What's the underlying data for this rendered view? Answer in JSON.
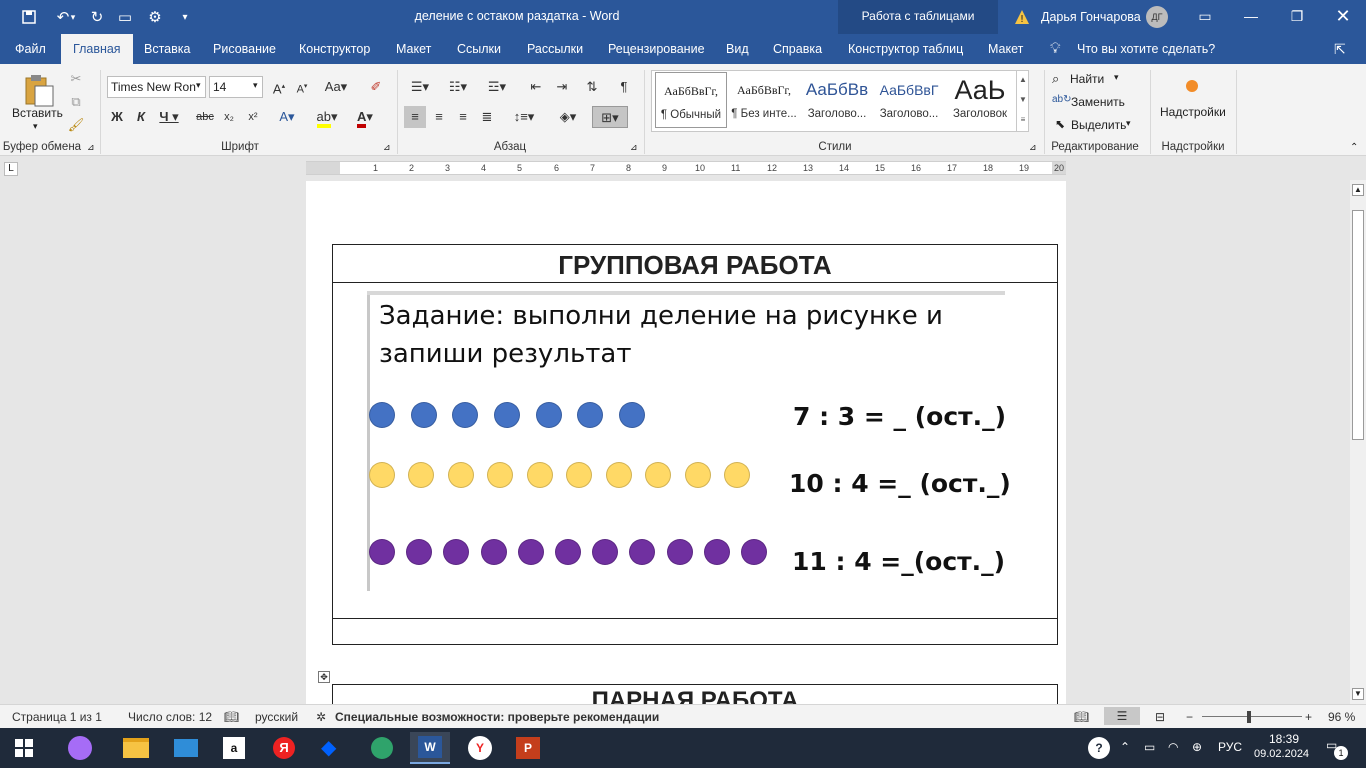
{
  "window": {
    "doc_title": "деление с остаком раздатка  -  Word",
    "table_tools": "Работа с таблицами",
    "user_name": "Дарья Гончарова",
    "user_initials": "ДГ"
  },
  "tabs": [
    {
      "label": "Файл"
    },
    {
      "label": "Главная"
    },
    {
      "label": "Вставка"
    },
    {
      "label": "Рисование"
    },
    {
      "label": "Конструктор"
    },
    {
      "label": "Макет"
    },
    {
      "label": "Ссылки"
    },
    {
      "label": "Рассылки"
    },
    {
      "label": "Рецензирование"
    },
    {
      "label": "Вид"
    },
    {
      "label": "Справка"
    },
    {
      "label": "Конструктор таблиц"
    },
    {
      "label": "Макет"
    }
  ],
  "tell_me": "Что вы хотите сделать?",
  "ribbon": {
    "paste": "Вставить",
    "clipboard_label": "Буфер обмена",
    "font_name": "Times New Ron",
    "font_size": "14",
    "font_label": "Шрифт",
    "paragraph_label": "Абзац",
    "styles_label": "Стили",
    "styles": [
      {
        "preview": "АаБбВвГг,",
        "name": "¶ Обычный"
      },
      {
        "preview": "АаБбВвГг,",
        "name": "¶ Без инте..."
      },
      {
        "preview": "АаБбВв",
        "name": "Заголово..."
      },
      {
        "preview": "АаБбВвГ",
        "name": "Заголово..."
      },
      {
        "preview": "АаЬ",
        "name": "Заголовок"
      }
    ],
    "find": "Найти",
    "replace": "Заменить",
    "select": "Выделить",
    "editing_label": "Редактирование",
    "addins": "Надстройки",
    "addins_label": "Надстройки"
  },
  "document": {
    "table_title": "ГРУППОВАЯ РАБОТА",
    "task_line1": "Задание: выполни деление на рисунке и",
    "task_line2": "запиши результат",
    "rows": [
      {
        "equation": "7 : 3 = _ (ост._)",
        "count": 7,
        "color": "#4472c4"
      },
      {
        "equation": "10 : 4 =_ (ост._)",
        "count": 10,
        "color": "#ffd966"
      },
      {
        "equation": "11 : 4 =_(ост._)",
        "count": 11,
        "color": "#7030a0"
      }
    ],
    "table2_title": "ПАРНАЯ   РАБОТА"
  },
  "status": {
    "page": "Страница 1 из 1",
    "words": "Число слов: 12",
    "language": "русский",
    "accessibility": "Специальные возможности: проверьте рекомендации",
    "zoom": "96 %"
  },
  "taskbar": {
    "language": "РУС",
    "time": "18:39",
    "date": "09.02.2024",
    "notifications": "1"
  }
}
